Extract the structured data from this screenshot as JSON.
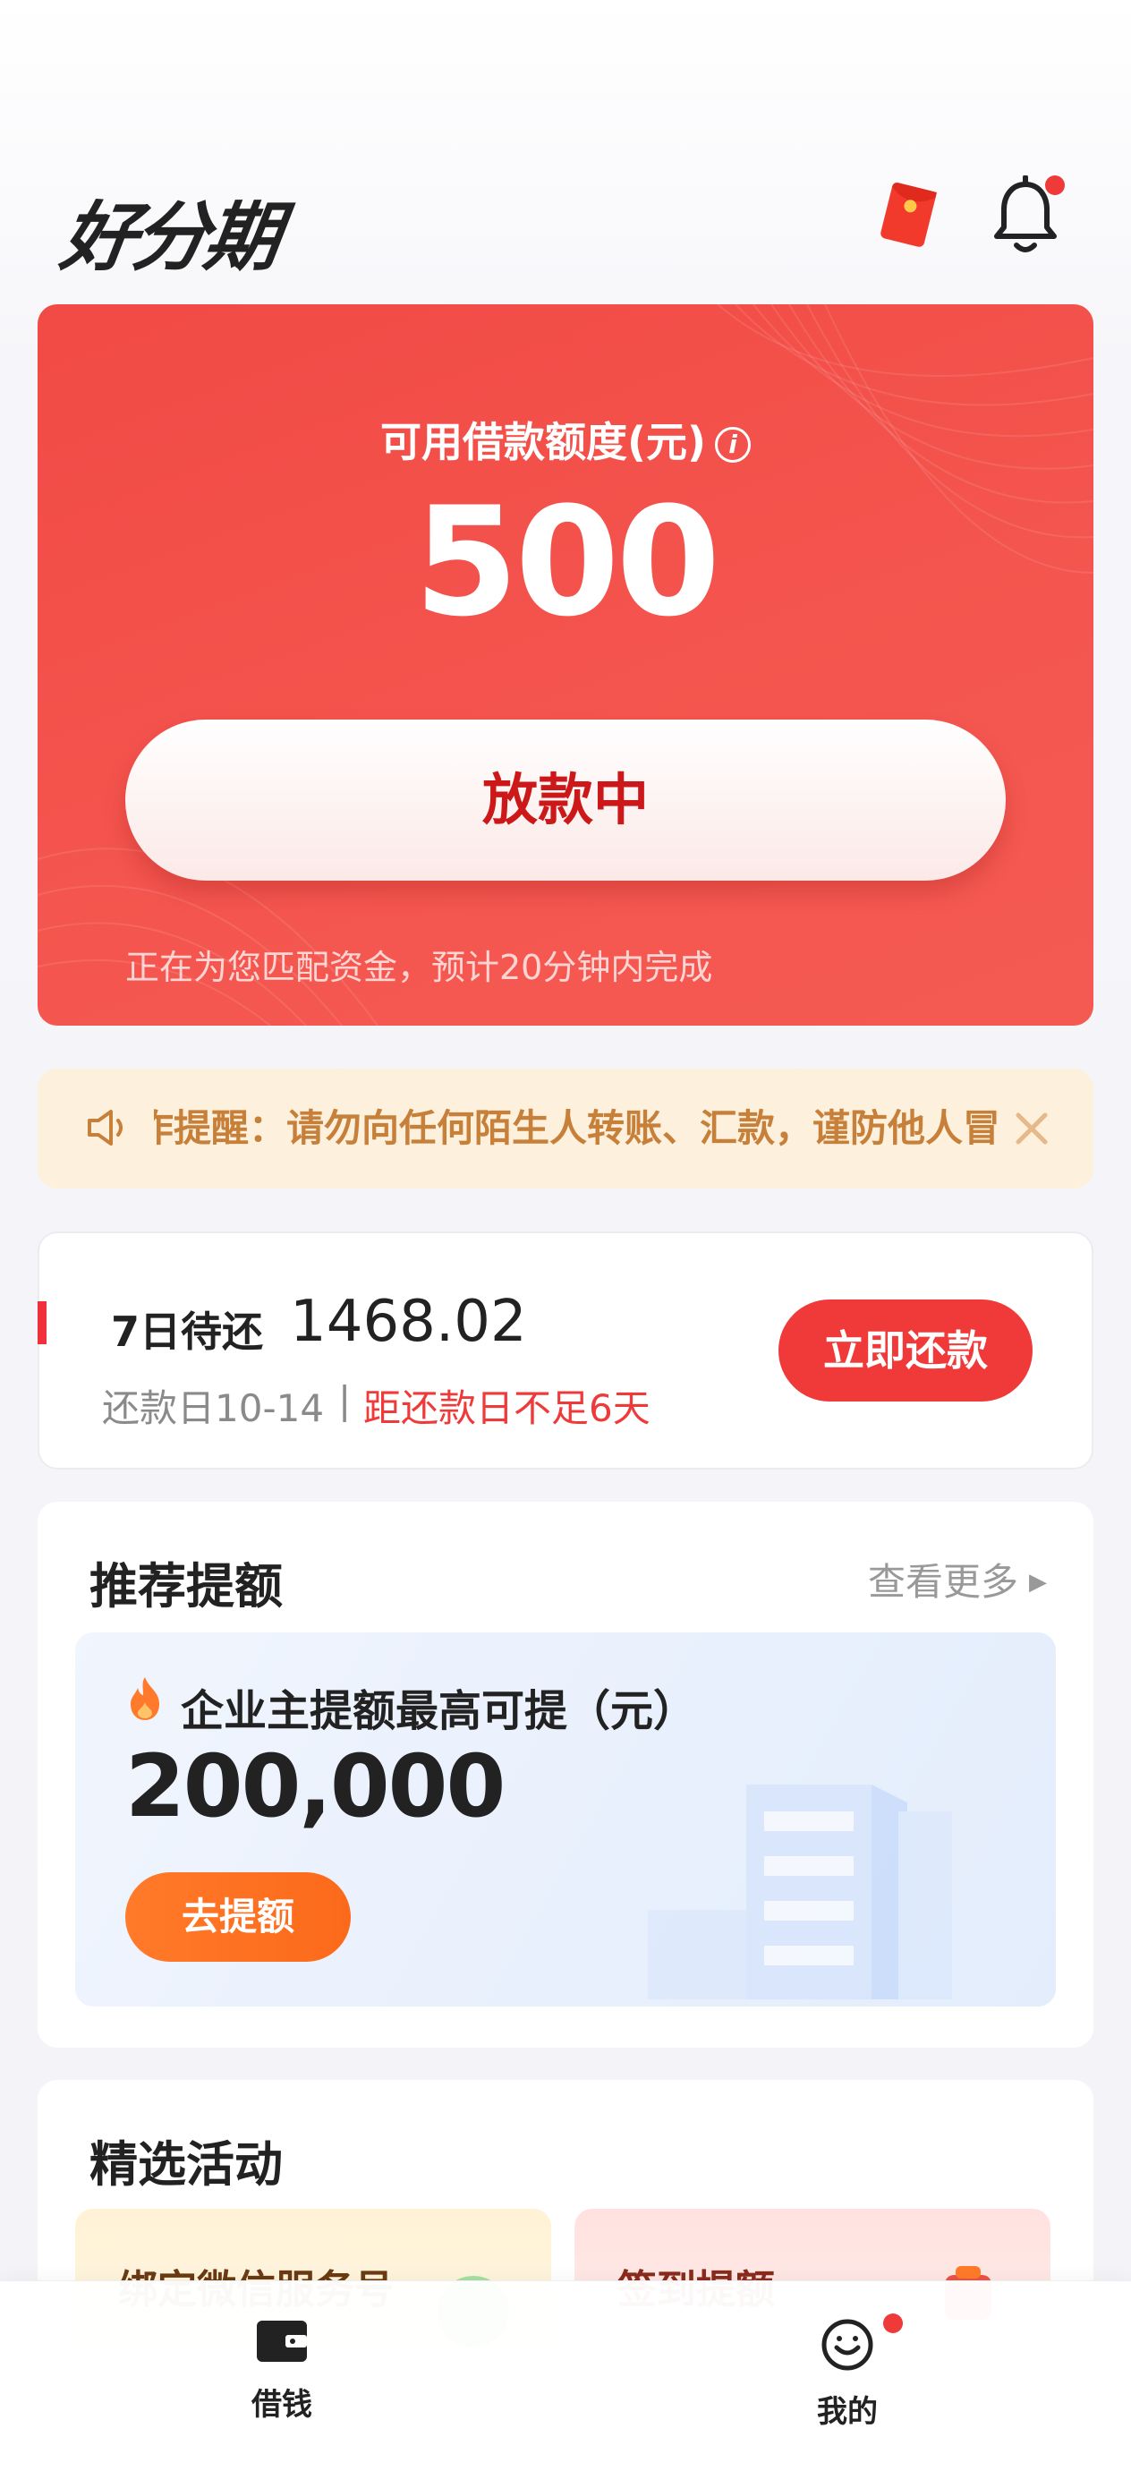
{
  "header": {
    "logo_text": "好分期",
    "redpacket_icon": "red-packet-icon",
    "bell_icon": "bell-icon",
    "bell_has_badge": true
  },
  "credit": {
    "title": "可用借款额度(元)",
    "info_icon": "info-icon",
    "amount": "500",
    "status_button": "放款中",
    "note": "正在为您匹配资金，预计20分钟内完成"
  },
  "notice": {
    "icon": "speaker-icon",
    "text": "诈提醒：请勿向任何陌生人转账、汇款，谨防他人冒",
    "close_icon": "close-icon"
  },
  "repayment": {
    "label": "7日待还",
    "amount": "1468.02",
    "due_date": "还款日10-14",
    "separator": "|",
    "warning": "距还款日不足6天",
    "button": "立即还款"
  },
  "recommend": {
    "title": "推荐提额",
    "more": "查看更多",
    "card": {
      "icon": "fire-icon",
      "title": "企业主提额最高可提（元）",
      "amount": "200,000",
      "button": "去提额"
    }
  },
  "activities": {
    "title": "精选活动",
    "items": [
      {
        "label": "绑定微信服务号"
      },
      {
        "label": "签到提额"
      }
    ]
  },
  "tabbar": {
    "items": [
      {
        "label": "借钱",
        "icon": "wallet-icon",
        "active": true
      },
      {
        "label": "我的",
        "icon": "smiley-icon",
        "has_badge": true
      }
    ]
  },
  "colors": {
    "brand_red": "#f24a45",
    "accent_orange": "#fb6a1a",
    "notice_bg": "#fdf0dc",
    "warning_red": "#f03a3a"
  }
}
